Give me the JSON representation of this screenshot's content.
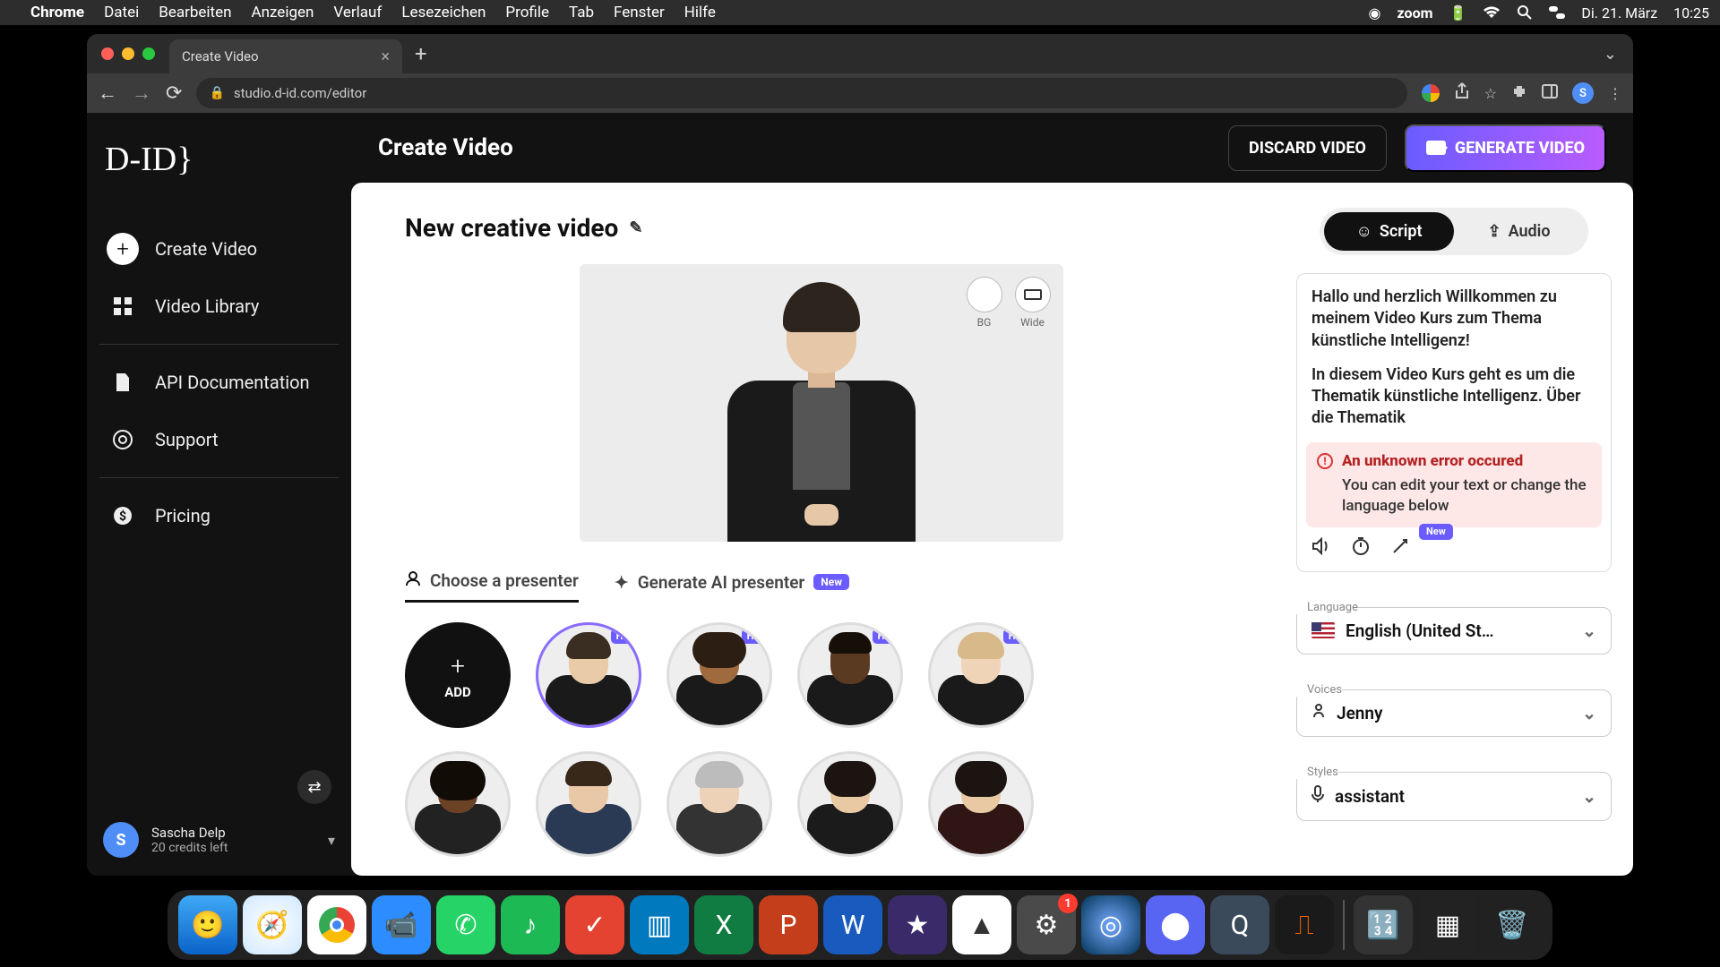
{
  "menubar": {
    "app": "Chrome",
    "items": [
      "Datei",
      "Bearbeiten",
      "Anzeigen",
      "Verlauf",
      "Lesezeichen",
      "Profile",
      "Tab",
      "Fenster",
      "Hilfe"
    ],
    "right": {
      "zoom": "zoom",
      "date": "Di. 21. März",
      "time": "10:25"
    }
  },
  "browser": {
    "tab_title": "Create Video",
    "url": "studio.d-id.com/editor"
  },
  "sidebar": {
    "logo": "D-ID}",
    "items": {
      "create": "Create Video",
      "library": "Video Library",
      "api": "API Documentation",
      "support": "Support",
      "pricing": "Pricing"
    },
    "user": {
      "name": "Sascha Delp",
      "credits": "20 credits left",
      "initial": "S"
    }
  },
  "header": {
    "title": "Create Video",
    "discard": "DISCARD VIDEO",
    "generate": "GENERATE VIDEO"
  },
  "canvas": {
    "title": "New creative video",
    "controls": {
      "bg": "BG",
      "wide": "Wide"
    },
    "tabs": {
      "choose": "Choose a presenter",
      "generate": "Generate AI presenter",
      "new": "New"
    },
    "add": "ADD",
    "hq": "HQ"
  },
  "right": {
    "tabs": {
      "script": "Script",
      "audio": "Audio"
    },
    "script_p1": "Hallo und herzlich Willkommen zu meinem Video Kurs zum Thema künstliche Intelligenz!",
    "script_p2": "In diesem Video Kurs geht es um die Thematik künstliche Intelligenz. Über die Thematik",
    "error_title": "An unknown error occured",
    "error_sub": "You can edit your text or change the language below",
    "new": "New",
    "language_label": "Language",
    "language_value": "English (United St…",
    "voices_label": "Voices",
    "voices_value": "Jenny",
    "styles_label": "Styles",
    "styles_value": "assistant"
  },
  "dock": {
    "settings_badge": "1"
  }
}
